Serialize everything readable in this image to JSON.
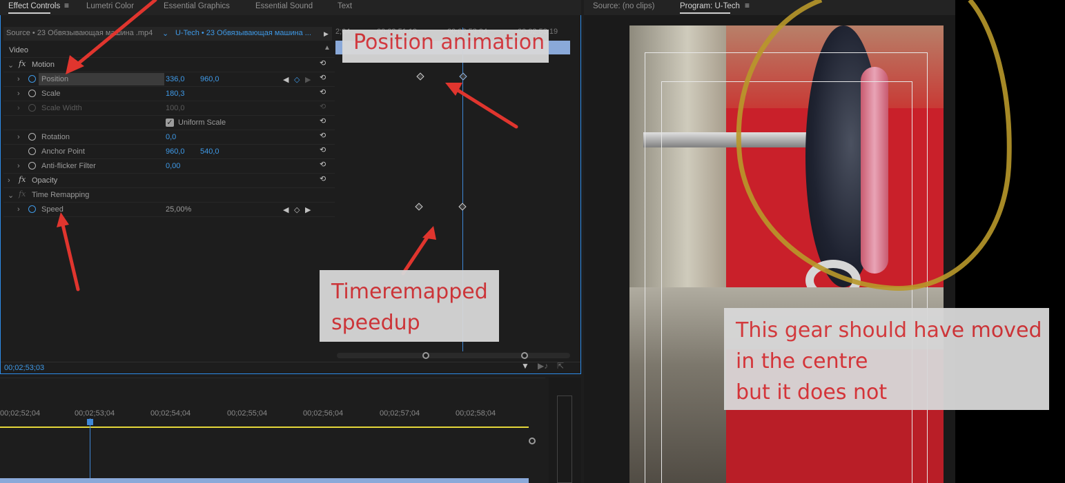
{
  "tabs_left": [
    {
      "label": "Effect Controls",
      "active": true
    },
    {
      "label": "Lumetri Color"
    },
    {
      "label": "Essential Graphics"
    },
    {
      "label": "Essential Sound"
    },
    {
      "label": "Text"
    }
  ],
  "tabs_right": [
    {
      "label": "Source: (no clips)"
    },
    {
      "label": "Program: U-Tech",
      "active": true
    }
  ],
  "source_row": {
    "source": "Source • 23 Обвязывающая машина .mp4",
    "sequence": "U-Tech • 23 Обвязывающая машина ..."
  },
  "timecodes_top": [
    "2;04",
    "00;02;51;19",
    "00;02;53;04",
    "00;02;53;19"
  ],
  "video_label": "Video",
  "motion": {
    "label": "Motion",
    "position": {
      "label": "Position",
      "x": "336,0",
      "y": "960,0"
    },
    "scale": {
      "label": "Scale",
      "value": "180,3"
    },
    "scale_width": {
      "label": "Scale Width",
      "value": "100,0"
    },
    "uniform_scale": {
      "label": "Uniform Scale",
      "checked": true
    },
    "rotation": {
      "label": "Rotation",
      "value": "0,0"
    },
    "anchor_point": {
      "label": "Anchor Point",
      "x": "960,0",
      "y": "540,0"
    },
    "anti_flicker": {
      "label": "Anti-flicker Filter",
      "value": "0,00"
    }
  },
  "opacity": {
    "label": "Opacity"
  },
  "time_remapping": {
    "label": "Time Remapping",
    "speed": {
      "label": "Speed",
      "value": "25,00%"
    }
  },
  "ec_current_time": "00;02;53;03",
  "timeline_tc": [
    "00;02;52;04",
    "00;02;53;04",
    "00;02;54;04",
    "00;02;55;04",
    "00;02;56;04",
    "00;02;57;04",
    "00;02;58;04"
  ],
  "annotations": {
    "position_anim": "Position animation",
    "time_remap": [
      "Timeremapped",
      "speedup"
    ],
    "gear_note": [
      "This gear should have moved",
      "in the centre",
      "but it does not"
    ]
  },
  "colors": {
    "accent": "#3f9ae8",
    "annotation_red": "#d6363a",
    "highlight_circle": "#b8982a"
  },
  "icons": {
    "stopwatch": "stopwatch-icon",
    "reset": "reset-icon",
    "fx": "fx-icon",
    "menu": "hamburger-menu-icon"
  }
}
